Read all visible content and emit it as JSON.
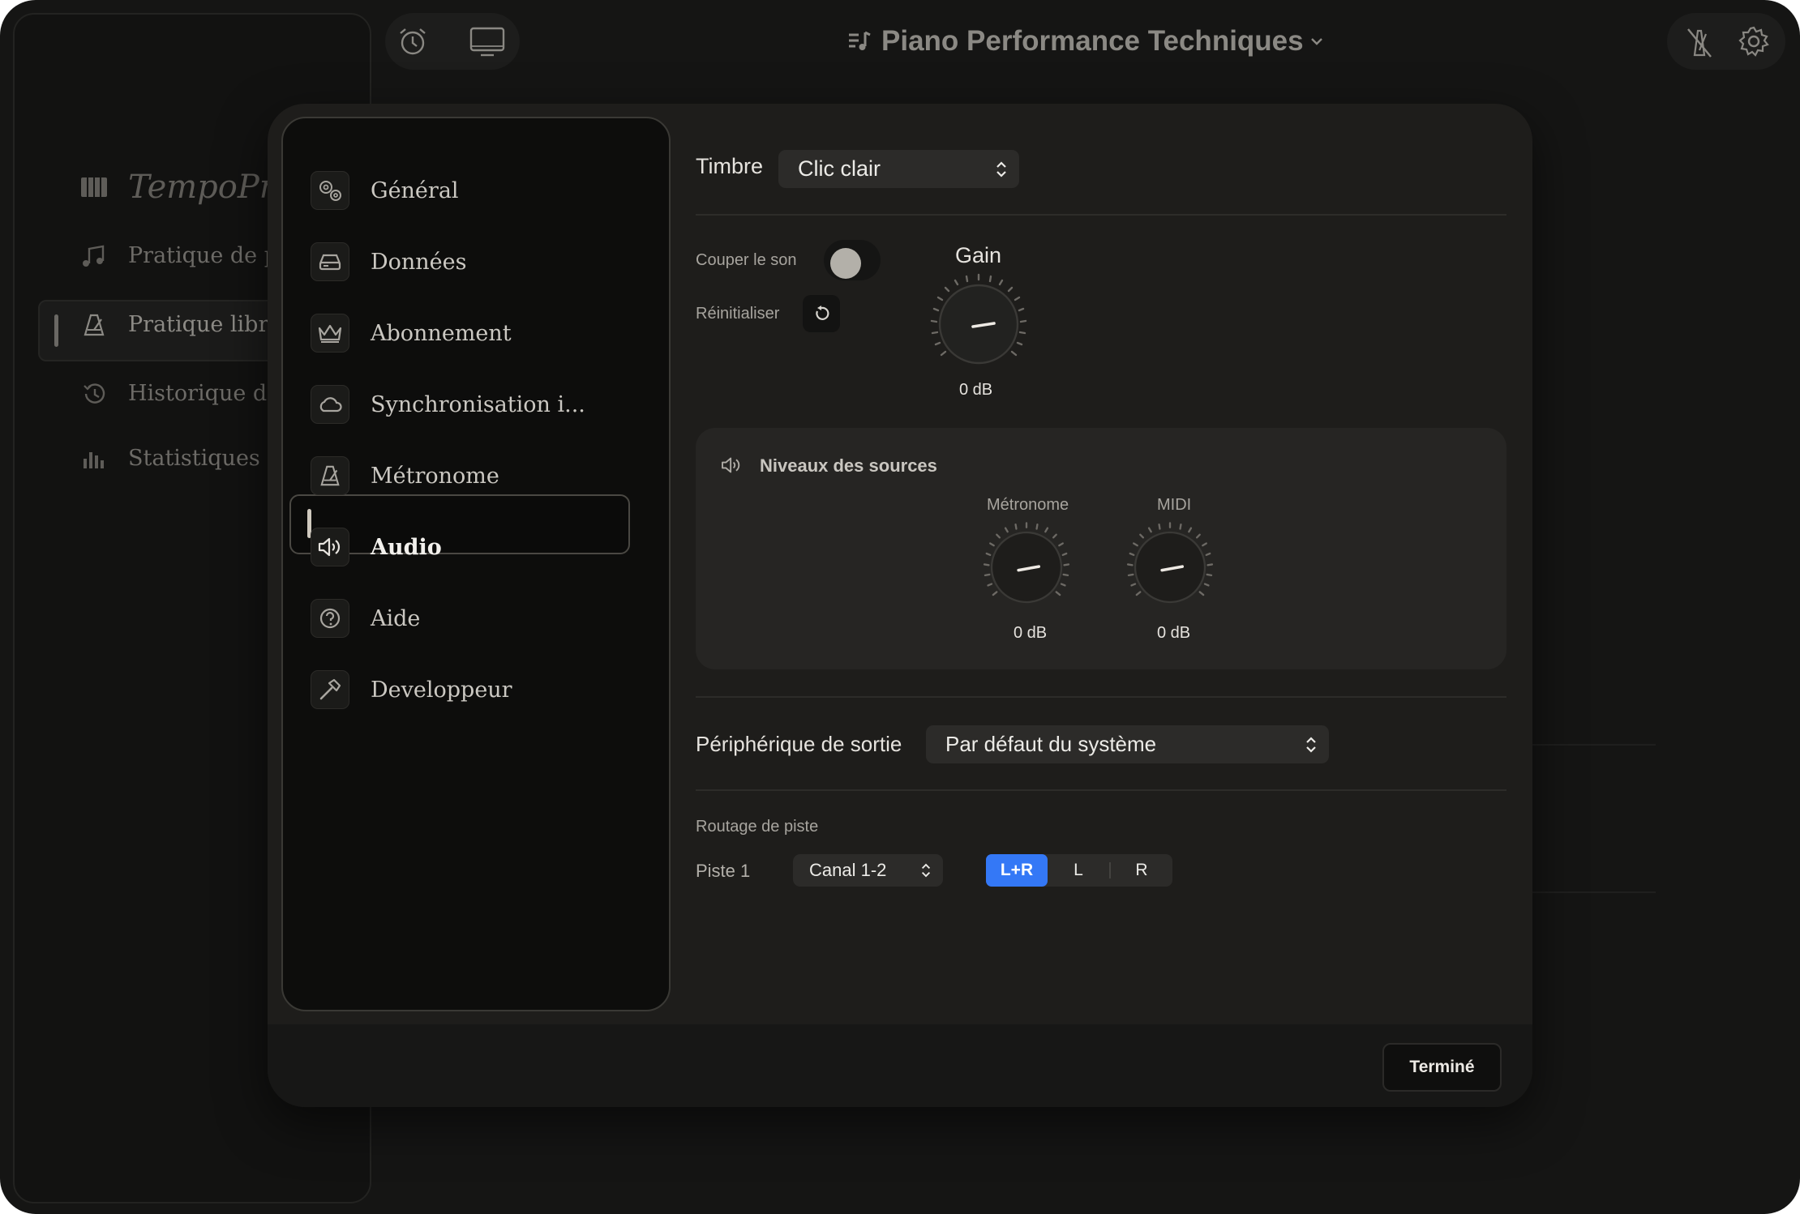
{
  "window": {
    "title": "Piano Performance Techniques"
  },
  "topbar": {
    "left_icons": [
      "person-card-icon",
      "sidebar-toggle-icon",
      "alarm-clock-icon",
      "display-icon"
    ],
    "right_icons": [
      "metronome-off-icon",
      "gear-icon"
    ]
  },
  "sidebar": {
    "app_name": "TempoPro",
    "items": [
      {
        "label": "Pratique de pi",
        "icon": "music-notes-icon"
      },
      {
        "label": "Pratique libre",
        "icon": "metronome-icon",
        "selected": true
      },
      {
        "label": "Historique de...",
        "icon": "history-icon"
      },
      {
        "label": "Statistiques",
        "icon": "bar-chart-icon"
      }
    ]
  },
  "settings": {
    "nav": [
      {
        "label": "Général",
        "icon": "gears-icon"
      },
      {
        "label": "Données",
        "icon": "drive-icon"
      },
      {
        "label": "Abonnement",
        "icon": "crown-icon"
      },
      {
        "label": "Synchronisation i...",
        "icon": "cloud-icon"
      },
      {
        "label": "Métronome",
        "icon": "metronome-icon"
      },
      {
        "label": "Audio",
        "icon": "speaker-icon",
        "selected": true
      },
      {
        "label": "Aide",
        "icon": "question-icon"
      },
      {
        "label": "Developpeur",
        "icon": "hammer-icon"
      }
    ],
    "done_label": "Terminé"
  },
  "audio": {
    "timbre_label": "Timbre",
    "timbre_value": "Clic clair",
    "mute_label": "Couper le son",
    "mute_on": false,
    "reset_label": "Réinitialiser",
    "gain_label": "Gain",
    "gain_value": "0 dB",
    "sources": {
      "title": "Niveaux des sources",
      "knobs": [
        {
          "label": "Métronome",
          "value": "0 dB"
        },
        {
          "label": "MIDI",
          "value": "0 dB"
        }
      ]
    },
    "output_label": "Périphérique de sortie",
    "output_value": "Par défaut du système",
    "routing_label": "Routage de piste",
    "track_label": "Piste 1",
    "channel_value": "Canal 1-2",
    "segments": [
      "L+R",
      "L",
      "R"
    ],
    "active_segment": "L+R"
  },
  "colors": {
    "accent": "#5b57e8",
    "segment_active": "#3478f6",
    "window_bg": "#151514",
    "modal_bg": "#1e1d1b"
  }
}
